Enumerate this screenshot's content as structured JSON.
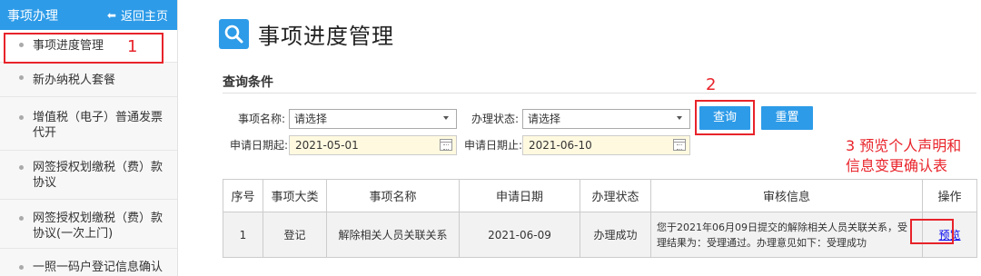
{
  "sidebar": {
    "title": "事项办理",
    "back_label": "返回主页",
    "items": [
      {
        "label": "事项进度管理"
      },
      {
        "label": "新办纳税人套餐"
      },
      {
        "label": "增值税（电子）普通发票代开"
      },
      {
        "label": "网签授权划缴税（费）款协议"
      },
      {
        "label": "网签授权划缴税（费）款协议(一次上门)"
      },
      {
        "label": "一照一码户登记信息确认"
      }
    ]
  },
  "page": {
    "title": "事项进度管理"
  },
  "query": {
    "section_label": "查询条件",
    "item_name_label": "事项名称:",
    "item_name_value": "请选择",
    "status_label": "办理状态:",
    "status_value": "请选择",
    "date_start_label": "申请日期起:",
    "date_start_value": "2021-05-01",
    "date_end_label": "申请日期止:",
    "date_end_value": "2021-06-10",
    "search_button": "查询",
    "reset_button": "重置"
  },
  "table": {
    "headers": [
      "序号",
      "事项大类",
      "事项名称",
      "申请日期",
      "办理状态",
      "审核信息",
      "操作"
    ],
    "rows": [
      {
        "index": "1",
        "category": "登记",
        "name": "解除相关人员关联关系",
        "date": "2021-06-09",
        "status": "办理成功",
        "review": "您于2021年06月09日提交的解除相关人员关联关系，受理结果为：受理通过。办理意见如下：受理成功",
        "action": "预览"
      }
    ]
  },
  "annotations": {
    "mark1": "1",
    "mark2": "2",
    "mark3_line1": "3 预览个人声明和",
    "mark3_line2": "信息变更确认表",
    "color": "#e8232a"
  },
  "colors": {
    "accent": "#2d9be8"
  }
}
